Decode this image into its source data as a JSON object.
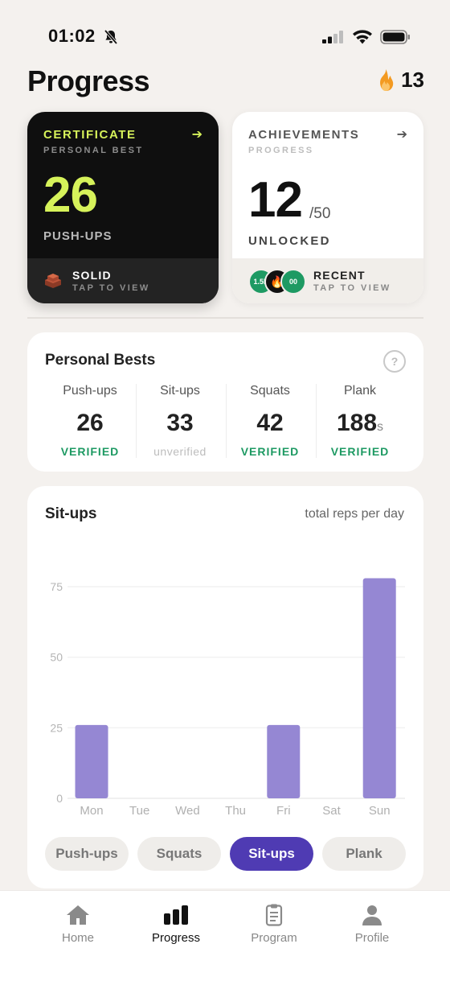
{
  "status_bar": {
    "time": "01:02"
  },
  "header": {
    "title": "Progress",
    "streak_count": "13",
    "streak_icon": "flame-icon"
  },
  "certificate_card": {
    "label": "CERTIFICATE",
    "sublabel": "PERSONAL BEST",
    "value": "26",
    "unit": "PUSH-UPS",
    "footer_title": "SOLID",
    "footer_sub": "TAP TO VIEW",
    "accent_color": "#d6f25a"
  },
  "achievements_card": {
    "label": "ACHIEVEMENTS",
    "sublabel": "PROGRESS",
    "value": "12",
    "total": "/50",
    "unit": "UNLOCKED",
    "footer_title": "RECENT",
    "footer_sub": "TAP TO VIEW",
    "badges": [
      "1.5K",
      "🔥",
      "00"
    ]
  },
  "personal_bests": {
    "title": "Personal Bests",
    "help": "?",
    "items": [
      {
        "name": "Push-ups",
        "value": "26",
        "suffix": "",
        "status": "VERIFIED"
      },
      {
        "name": "Sit-ups",
        "value": "33",
        "suffix": "",
        "status": "unverified"
      },
      {
        "name": "Squats",
        "value": "42",
        "suffix": "",
        "status": "VERIFIED"
      },
      {
        "name": "Plank",
        "value": "188",
        "suffix": "s",
        "status": "VERIFIED"
      }
    ]
  },
  "chart_card": {
    "title": "Sit-ups",
    "note": "total reps per day",
    "segments": [
      "Push-ups",
      "Squats",
      "Sit-ups",
      "Plank"
    ],
    "active_segment": "Sit-ups"
  },
  "chart_data": {
    "type": "bar",
    "categories": [
      "Mon",
      "Tue",
      "Wed",
      "Thu",
      "Fri",
      "Sat",
      "Sun"
    ],
    "values": [
      26,
      0,
      0,
      0,
      26,
      0,
      78
    ],
    "yticks": [
      0,
      25,
      50,
      75
    ],
    "ylim": [
      0,
      85
    ],
    "grid": true,
    "bar_color": "#9587d3"
  },
  "tabbar": {
    "items": [
      {
        "label": "Home",
        "icon": "home-icon"
      },
      {
        "label": "Progress",
        "icon": "bar-chart-icon"
      },
      {
        "label": "Program",
        "icon": "clipboard-icon"
      },
      {
        "label": "Profile",
        "icon": "person-icon"
      }
    ],
    "active": "Progress"
  }
}
